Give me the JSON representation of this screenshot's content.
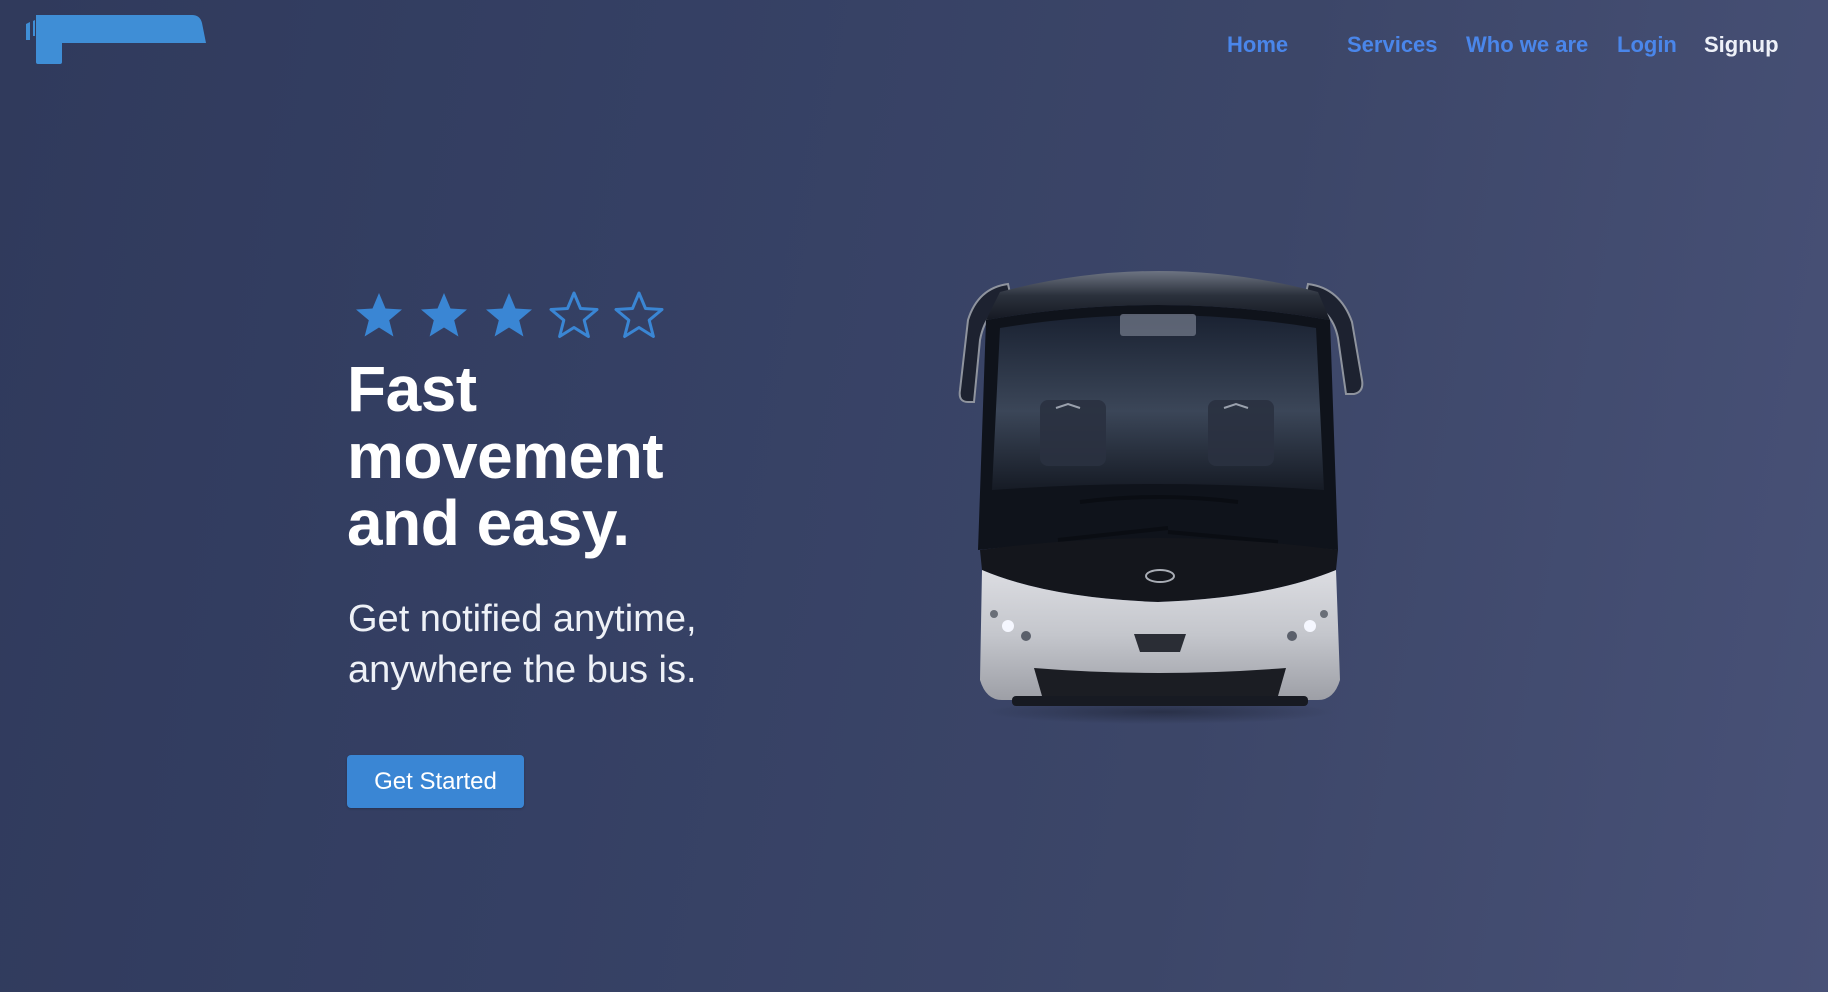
{
  "brand": {
    "logo_icon": "bus-logo",
    "accent_color": "#4a86ea",
    "button_color": "#3a86d4",
    "background_start": "#303a5c",
    "background_end": "#485177"
  },
  "nav": {
    "items": [
      {
        "label": "Home"
      },
      {
        "label": "Services"
      },
      {
        "label": "Who we are"
      },
      {
        "label": "Login"
      },
      {
        "label": "Signup"
      }
    ]
  },
  "hero": {
    "rating": {
      "value": 3,
      "max": 5
    },
    "headline": "Fast movement and easy.",
    "subheadline": "Get notified anytime, anywhere the bus is.",
    "cta_label": "Get Started",
    "image": "coach-bus-front"
  }
}
